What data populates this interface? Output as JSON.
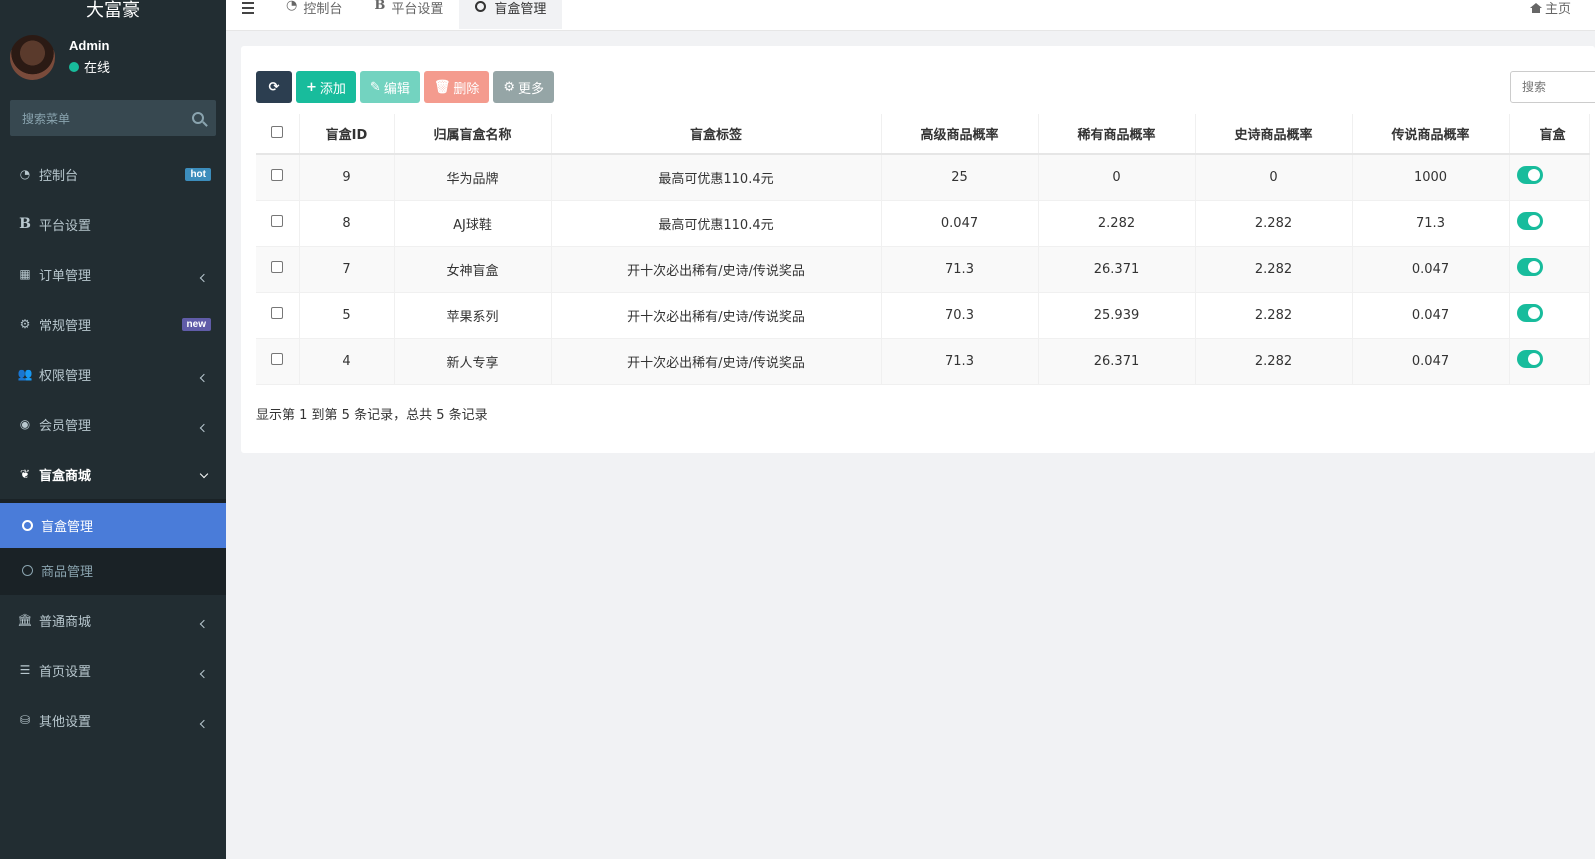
{
  "app": {
    "brand": "大富豪"
  },
  "user": {
    "name": "Admin",
    "status": "在线"
  },
  "sidebar": {
    "search_placeholder": "搜索菜单",
    "items": [
      {
        "label": "控制台",
        "icon": "dashboard-icon",
        "badge": "hot"
      },
      {
        "label": "平台设置",
        "icon": "bold-b-icon"
      },
      {
        "label": "订单管理",
        "icon": "calculator-icon"
      },
      {
        "label": "常规管理",
        "icon": "cogs-icon",
        "badge": "new"
      },
      {
        "label": "权限管理",
        "icon": "group-icon"
      },
      {
        "label": "会员管理",
        "icon": "user-circle-icon"
      },
      {
        "label": "盲盒商城",
        "icon": "leaf-icon"
      },
      {
        "label": "普通商城",
        "icon": "bank-icon"
      },
      {
        "label": "首页设置",
        "icon": "list-icon"
      },
      {
        "label": "其他设置",
        "icon": "database-icon"
      }
    ],
    "submenu": [
      {
        "label": "盲盒管理",
        "active": true
      },
      {
        "label": "商品管理",
        "active": false
      }
    ]
  },
  "topnav": {
    "tabs": [
      {
        "label": "控制台",
        "icon": "dashboard-icon"
      },
      {
        "label": "平台设置",
        "icon": "bold-b-icon"
      },
      {
        "label": "盲盒管理",
        "icon": "circle-icon",
        "active": true
      }
    ],
    "home_label": "主页"
  },
  "toolbar": {
    "add": "添加",
    "edit": "编辑",
    "delete": "删除",
    "more": "更多",
    "search_placeholder": "搜索"
  },
  "table": {
    "columns": [
      "盲盒ID",
      "归属盲盒名称",
      "盲盒标签",
      "高级商品概率",
      "稀有商品概率",
      "史诗商品概率",
      "传说商品概率",
      "盲盒"
    ],
    "rows": [
      {
        "id": "9",
        "name": "华为品牌",
        "tag": "最高可优惠110.4元",
        "adv": "25",
        "rare": "0",
        "epic": "0",
        "legend": "1000"
      },
      {
        "id": "8",
        "name": "AJ球鞋",
        "tag": "最高可优惠110.4元",
        "adv": "0.047",
        "rare": "2.282",
        "epic": "2.282",
        "legend": "71.3"
      },
      {
        "id": "7",
        "name": "女神盲盒",
        "tag": "开十次必出稀有/史诗/传说奖品",
        "adv": "71.3",
        "rare": "26.371",
        "epic": "2.282",
        "legend": "0.047"
      },
      {
        "id": "5",
        "name": "苹果系列",
        "tag": "开十次必出稀有/史诗/传说奖品",
        "adv": "70.3",
        "rare": "25.939",
        "epic": "2.282",
        "legend": "0.047"
      },
      {
        "id": "4",
        "name": "新人专享",
        "tag": "开十次必出稀有/史诗/传说奖品",
        "adv": "71.3",
        "rare": "26.371",
        "epic": "2.282",
        "legend": "0.047"
      }
    ]
  },
  "pagination": {
    "info": "显示第 1 到第 5 条记录，总共 5 条记录"
  },
  "colors": {
    "sidebar_bg": "#222d32",
    "accent": "#18bc9c",
    "active_sub": "#4a7cd9"
  }
}
